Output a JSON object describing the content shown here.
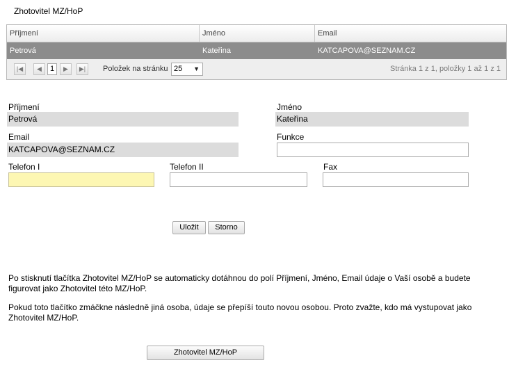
{
  "title": "Zhotovitel MZ/HoP",
  "grid": {
    "columns": [
      "Příjmení",
      "Jméno",
      "Email"
    ],
    "rows": [
      {
        "prijmeni": "Petrová",
        "jmeno": "Kateřina",
        "email": "KATCAPOVA@SEZNAM.CZ"
      }
    ],
    "pager": {
      "current_page": "1",
      "per_page_label": "Položek na stránku",
      "per_page_value": "25",
      "info": "Stránka 1 z 1, položky 1 až 1 z 1"
    }
  },
  "form": {
    "prijmeni_label": "Příjmení",
    "prijmeni_value": "Petrová",
    "jmeno_label": "Jméno",
    "jmeno_value": "Kateřina",
    "email_label": "Email",
    "email_value": "KATCAPOVA@SEZNAM.CZ",
    "funkce_label": "Funkce",
    "funkce_value": "",
    "telefon1_label": "Telefon I",
    "telefon1_value": "",
    "telefon2_label": "Telefon II",
    "telefon2_value": "",
    "fax_label": "Fax",
    "fax_value": "",
    "save_label": "Uložit",
    "cancel_label": "Storno"
  },
  "notes": {
    "line1": "Po stisknutí tlačítka Zhotovitel MZ/HoP se automaticky dotáhnou do polí Příjmení, Jméno, Email údaje o Vaší osobě a budete figurovat jako Zhotovitel této MZ/HoP.",
    "line2": "Pokud toto tlačítko zmáčkne následně jiná osoba, údaje se přepíší touto novou osobou. Proto zvažte, kdo má vystupovat jako Zhotovitel MZ/HoP."
  },
  "zhotovitel_button_label": "Zhotovitel MZ/HoP",
  "colors": {
    "selected_row": "#8c8c8c",
    "readonly_field": "#dcdcdc",
    "focused_field": "#fdf7b3"
  },
  "icons": [
    "first-page-icon",
    "prev-page-icon",
    "next-page-icon",
    "last-page-icon",
    "dropdown-arrow-icon"
  ]
}
